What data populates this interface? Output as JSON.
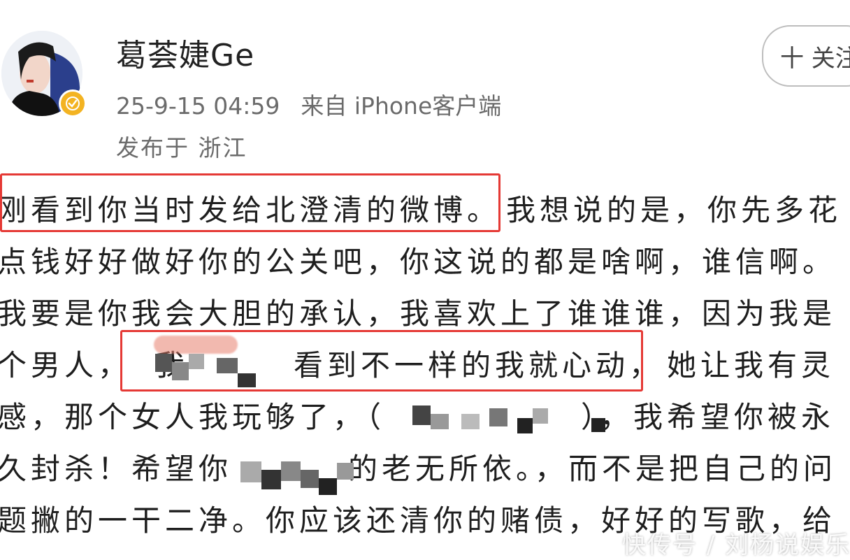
{
  "post": {
    "username": "葛荟婕Ge",
    "timestamp": "25-9-15 04:59",
    "source": "来自 iPhone客户端",
    "location": "发布于 浙江",
    "follow_label": "十 关注"
  },
  "content": {
    "lines": [
      "刚看到你当时发给北澄清的微博。我想说的是，你先多花",
      "点钱好好做好你的公关吧，你这说的都是啥啊，谁信啊。",
      "我要是你我会大胆的承认，我喜欢上了谁谁谁，因为我是",
      "个男人，",
      "看到不一样的我就心动，她让我有灵",
      "感，那个女人我玩够了，（",
      "），我希望你被永",
      "久封杀！希望你",
      "的老无所依。，而不是把自己的问",
      "题撇的一干二净。你应该还清你的赌债，好好的写歌，给"
    ],
    "line4_prefix": "个男人，",
    "line4_highlight_start": "我",
    "line4_highlight_text": "看到不一样的我就心动，",
    "line4_suffix": "她让我有灵",
    "line5_prefix": "感，那个女人我玩够了，（",
    "line5_suffix": "），我希望你被永",
    "line6_prefix": "久封杀！希望你",
    "line6_suffix": "的老无所依。，而不是把自己的问",
    "line1_highlight": "刚看到你当时发给北澄清的微博。",
    "line1_suffix": "我想说的是，你先多花"
  },
  "watermark": "快传号 / 刘杨说娱乐",
  "colors": {
    "highlight_border": "#e53935",
    "verified_badge": "#f3b322",
    "meta_text": "#6b6b6b"
  },
  "icons": {
    "verified": "verified-badge-icon",
    "plus": "plus-icon"
  }
}
